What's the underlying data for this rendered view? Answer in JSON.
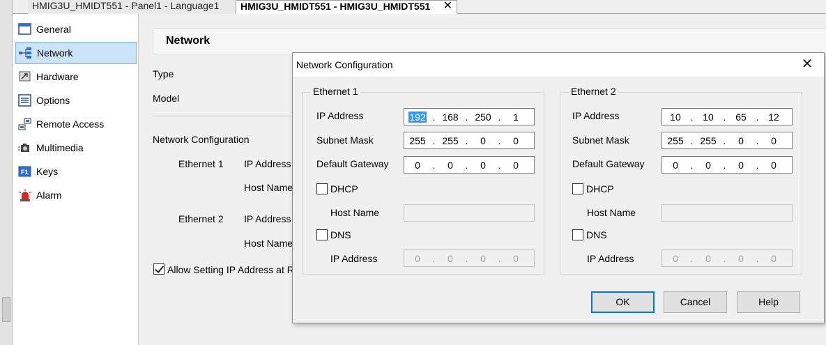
{
  "tabs": [
    {
      "label": "HMIG3U_HMIDT551 - Panel1 - Language1"
    },
    {
      "label": "HMIG3U_HMIDT551 - HMIG3U_HMIDT551"
    }
  ],
  "sidebar": {
    "items": [
      {
        "label": "General",
        "icon": "window-icon"
      },
      {
        "label": "Network",
        "icon": "network-icon"
      },
      {
        "label": "Hardware",
        "icon": "hardware-icon"
      },
      {
        "label": "Options",
        "icon": "options-icon"
      },
      {
        "label": "Remote Access",
        "icon": "remote-access-icon"
      },
      {
        "label": "Multimedia",
        "icon": "camera-icon"
      },
      {
        "label": "Keys",
        "icon": "f1-key-icon"
      },
      {
        "label": "Alarm",
        "icon": "alarm-icon"
      }
    ]
  },
  "main": {
    "section_title": "Network",
    "type_label": "Type",
    "model_label": "Model",
    "netconfig_label": "Network Configuration",
    "eth1_label": "Ethernet 1",
    "eth2_label": "Ethernet 2",
    "ip_address_label": "IP Address",
    "host_name_label": "Host Name",
    "allow_label": "Allow Setting IP Address at Ru"
  },
  "dialog": {
    "title": "Network Configuration",
    "ethernet1": {
      "title": "Ethernet 1",
      "ip_label": "IP Address",
      "ip": [
        "192",
        "168",
        "250",
        "1"
      ],
      "subnet_label": "Subnet Mask",
      "subnet": [
        "255",
        "255",
        "0",
        "0"
      ],
      "gateway_label": "Default Gateway",
      "gateway": [
        "0",
        "0",
        "0",
        "0"
      ],
      "dhcp_label": "DHCP",
      "host_label": "Host Name",
      "dns_label": "DNS",
      "dns_ip_label": "IP Address",
      "dns_ip": [
        "0",
        "0",
        "0",
        "0"
      ]
    },
    "ethernet2": {
      "title": "Ethernet 2",
      "ip_label": "IP Address",
      "ip": [
        "10",
        "10",
        "65",
        "12"
      ],
      "subnet_label": "Subnet Mask",
      "subnet": [
        "255",
        "255",
        "0",
        "0"
      ],
      "gateway_label": "Default Gateway",
      "gateway": [
        "0",
        "0",
        "0",
        "0"
      ],
      "dhcp_label": "DHCP",
      "host_label": "Host Name",
      "dns_label": "DNS",
      "dns_ip_label": "IP Address",
      "dns_ip": [
        "0",
        "0",
        "0",
        "0"
      ]
    },
    "buttons": {
      "ok": "OK",
      "cancel": "Cancel",
      "help": "Help"
    }
  },
  "colors": {
    "selection": "#3399ff",
    "sidebar_selected": "#cce4f7",
    "default_button_border": "#0078d7"
  }
}
